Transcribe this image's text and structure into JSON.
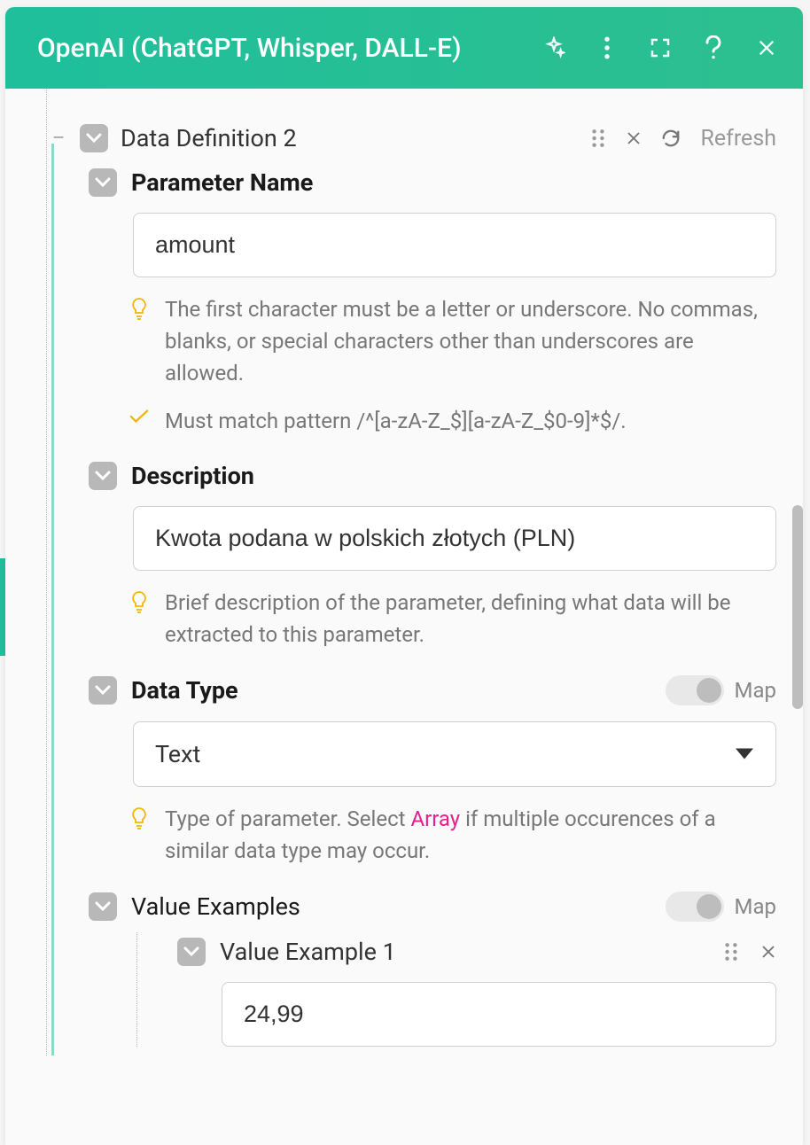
{
  "header": {
    "title": "OpenAI (ChatGPT, Whisper, DALL-E)"
  },
  "section": {
    "title": "Data Definition 2",
    "refresh_label": "Refresh"
  },
  "fields": {
    "paramName": {
      "label": "Parameter Name",
      "value": "amount",
      "hint1": "The first character must be a letter or underscore. No commas, blanks, or special characters other than underscores are allowed.",
      "hint2": "Must match pattern /^[a-zA-Z_$][a-zA-Z_$0-9]*$/."
    },
    "description": {
      "label": "Description",
      "value": "Kwota podana w polskich złotych (PLN)",
      "hint": "Brief description of the parameter, defining what data will be extracted to this parameter."
    },
    "dataType": {
      "label": "Data Type",
      "value": "Text",
      "map_label": "Map",
      "hint_pre": "Type of parameter. Select ",
      "hint_pink": "Array",
      "hint_post": " if multiple occurences of a similar data type may occur."
    },
    "valueExamples": {
      "label": "Value Examples",
      "map_label": "Map",
      "items": [
        {
          "title": "Value Example 1",
          "value": "24,99"
        }
      ]
    }
  }
}
